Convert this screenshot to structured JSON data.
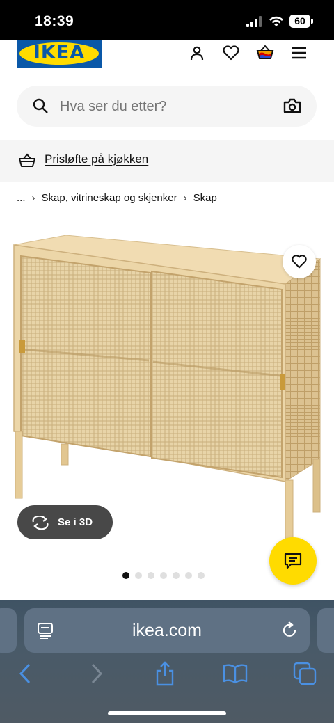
{
  "status_bar": {
    "time": "18:39",
    "battery": "60"
  },
  "header": {
    "logo_text": "IKEA"
  },
  "search": {
    "placeholder": "Hva ser du etter?"
  },
  "promo": {
    "text": "Prisløfte på kjøkken"
  },
  "breadcrumb": {
    "items": [
      "...",
      "Skap, vitrineskap og skjenker",
      "Skap"
    ]
  },
  "product": {
    "view_3d_label": "Se i 3D",
    "image_count": 7,
    "active_image": 1
  },
  "browser": {
    "url": "ikea.com"
  },
  "icons": {
    "account": "person-icon",
    "wishlist": "heart-icon",
    "cart": "basket-icon",
    "menu": "hamburger-icon",
    "search": "magnifier-icon",
    "camera": "camera-icon",
    "chat": "chat-icon"
  },
  "colors": {
    "ikea_blue": "#0a58a8",
    "ikea_yellow": "#ffdb00",
    "safari_bar": "#495a68",
    "safari_accent": "#4a90e2"
  }
}
